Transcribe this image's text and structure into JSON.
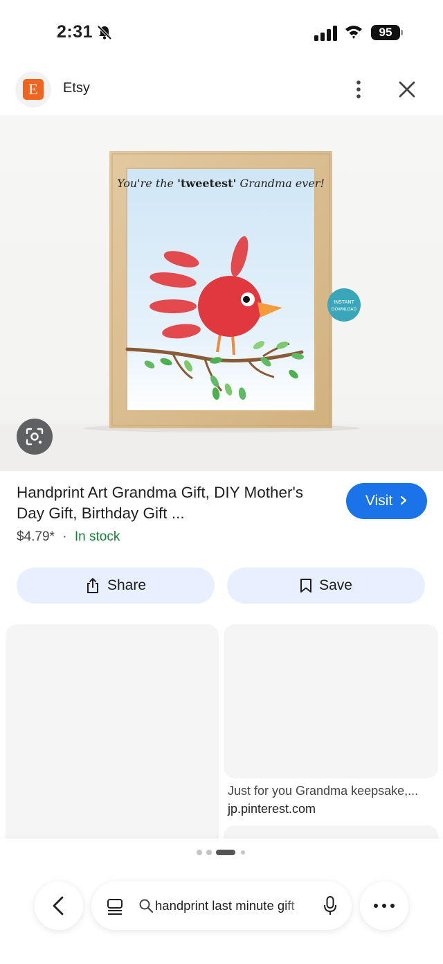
{
  "status_bar": {
    "time": "2:31",
    "battery": "95"
  },
  "header": {
    "source_name": "Etsy",
    "logo_letter": "E"
  },
  "image": {
    "frame_text_prefix": "You're the",
    "frame_text_bold": "'tweetest'",
    "frame_text_suffix": "Grandma ever!",
    "badge_text_1": "INSTANT",
    "badge_text_2": "DOWNLOAD"
  },
  "product": {
    "title": "Handprint Art Grandma Gift, DIY Mother's Day Gift, Birthday Gift ...",
    "price": "$4.79*",
    "separator": "·",
    "stock": "In stock",
    "visit_label": "Visit"
  },
  "actions": {
    "share_label": "Share",
    "save_label": "Save"
  },
  "related": {
    "caption": "Just for you Grandma keepsake,...",
    "domain": "jp.pinterest.com"
  },
  "search": {
    "query": "handprint last minute gift"
  },
  "colors": {
    "accent": "#1a73e8",
    "etsy": "#f1641e",
    "stock": "#188038",
    "action_bg": "#e8effe"
  }
}
